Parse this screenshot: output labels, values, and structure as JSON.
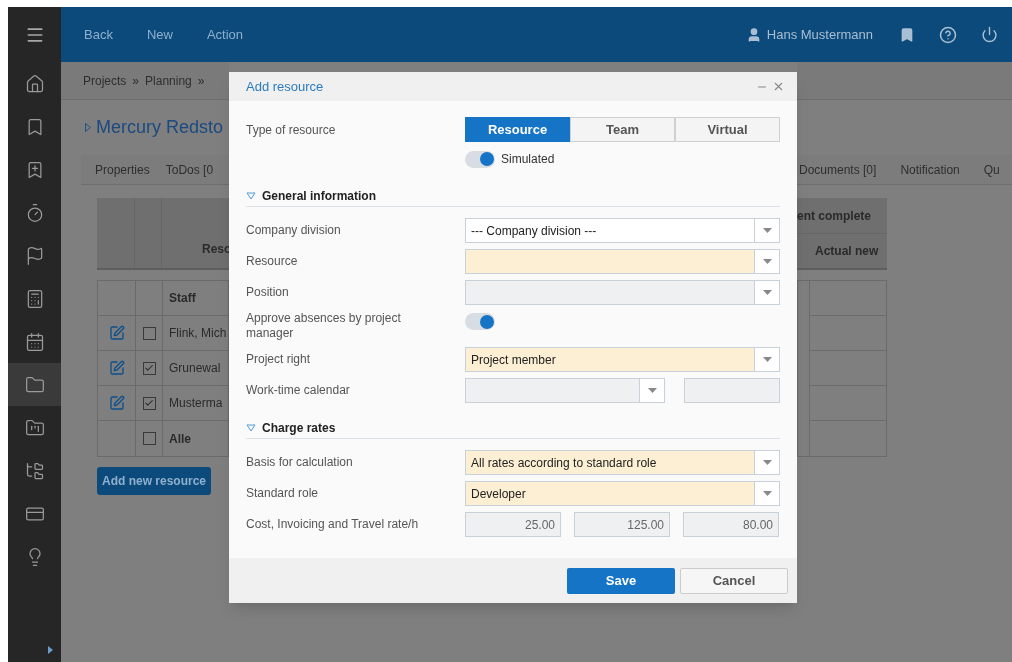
{
  "top_bar": {
    "menu": [
      "Back",
      "New",
      "Action"
    ],
    "user": "Hans Mustermann"
  },
  "sidebar": {
    "items": [
      {
        "selected": false
      },
      {
        "selected": false
      },
      {
        "selected": false
      },
      {
        "selected": false
      },
      {
        "selected": false
      },
      {
        "selected": false
      },
      {
        "selected": false
      },
      {
        "selected": true
      },
      {
        "selected": false
      },
      {
        "selected": false
      },
      {
        "selected": false
      },
      {
        "selected": false
      }
    ]
  },
  "breadcrumb": {
    "items": [
      "Projects",
      "Planning"
    ],
    "separator": "»"
  },
  "project_title": "Mercury Redsto",
  "tabs": [
    {
      "label": "Properties"
    },
    {
      "label": "ToDos [0"
    },
    {
      "label": "Documents [0]"
    },
    {
      "label": "Notification"
    },
    {
      "label": "Qu"
    }
  ],
  "resource_table": {
    "left_header": "Reso",
    "right_headers": [
      "ent complete",
      "Actual new"
    ],
    "staff_header": "Staff",
    "rows": [
      {
        "kind": "person",
        "name": "Flink, Mich",
        "checked": false
      },
      {
        "kind": "person",
        "name": "Grunewal",
        "checked": true
      },
      {
        "kind": "person",
        "name": "Musterma",
        "checked": true
      },
      {
        "kind": "total",
        "name": "Alle",
        "checked": false
      }
    ]
  },
  "add_button": "Add new resource",
  "dialog": {
    "title": "Add resource",
    "type_of_resource": {
      "label": "Type of resource",
      "options": [
        {
          "label": "Resource",
          "selected": true
        },
        {
          "label": "Team",
          "selected": false
        },
        {
          "label": "Virtual",
          "selected": false
        }
      ]
    },
    "simulated": {
      "label": "Simulated",
      "on": true
    },
    "sections": [
      {
        "title": "General information",
        "expanded": true,
        "fields": [
          {
            "kind": "select",
            "label": "Company division",
            "value": "--- Company division ---",
            "required": false,
            "disabled": false
          },
          {
            "kind": "select",
            "label": "Resource",
            "required": true,
            "disabled": false
          },
          {
            "kind": "select",
            "label": "Position",
            "disabled": true
          },
          {
            "kind": "toggle",
            "label": "Approve absences by project manager",
            "on": true
          },
          {
            "kind": "select",
            "label": "Project right",
            "value": "Project member",
            "required": true,
            "disabled": false
          },
          {
            "kind": "select_with_field",
            "label": "Work-time calendar",
            "disabled": true
          }
        ]
      },
      {
        "title": "Charge rates",
        "expanded": true,
        "fields": [
          {
            "kind": "select",
            "label": "Basis for calculation",
            "value": "All rates according to standard role",
            "required": true,
            "disabled": false
          },
          {
            "kind": "select",
            "label": "Standard role",
            "value": "Developer",
            "required": true,
            "disabled": false
          },
          {
            "kind": "numbers",
            "label": "Cost, Invoicing and Travel rate/h",
            "values": [
              "25.00",
              "125.00",
              "80.00"
            ],
            "disabled": true
          }
        ]
      }
    ],
    "buttons": [
      {
        "label": "Save",
        "kind": "primary"
      },
      {
        "label": "Cancel",
        "kind": "secondary"
      }
    ]
  }
}
